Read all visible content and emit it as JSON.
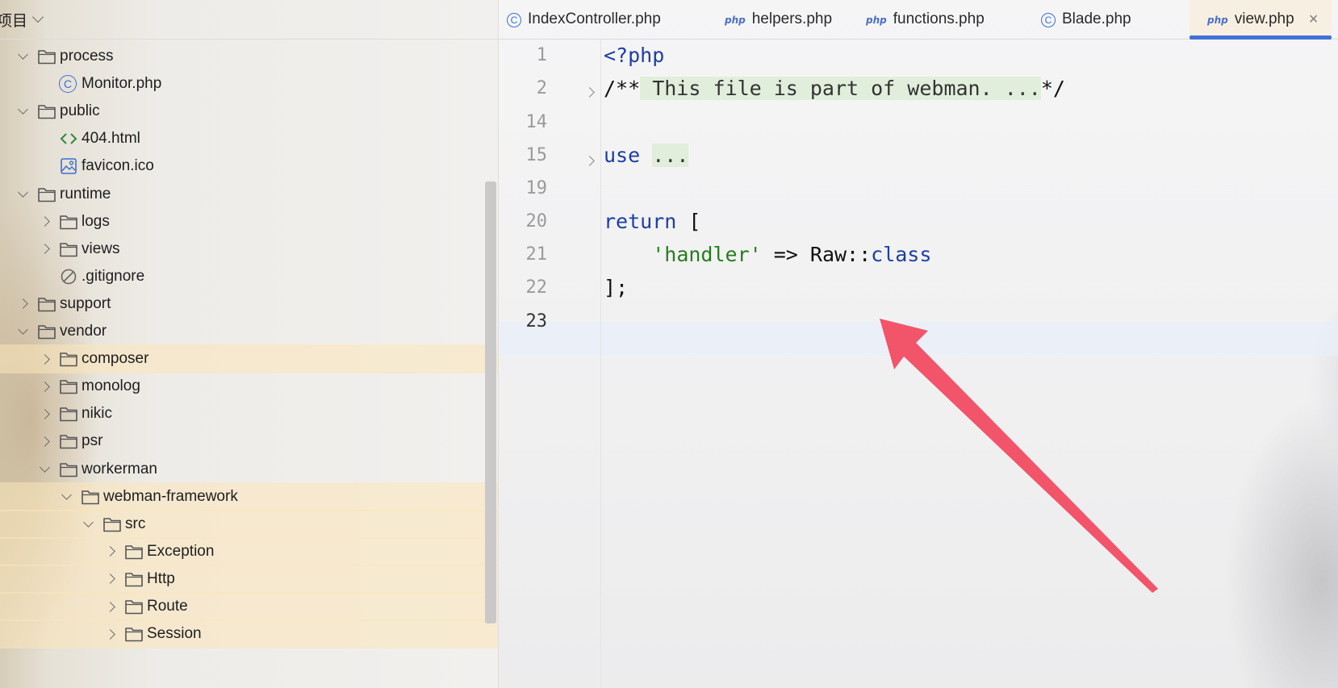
{
  "tree_header": {
    "title": "项目"
  },
  "tree": [
    {
      "label": "process",
      "type": "folder",
      "state": "open",
      "depth": 1,
      "highlight": false
    },
    {
      "label": "Monitor.php",
      "type": "class",
      "depth": 2,
      "highlight": false
    },
    {
      "label": "public",
      "type": "folder",
      "state": "open",
      "depth": 1,
      "highlight": false
    },
    {
      "label": "404.html",
      "type": "html",
      "depth": 2,
      "highlight": false
    },
    {
      "label": "favicon.ico",
      "type": "image",
      "depth": 2,
      "highlight": false
    },
    {
      "label": "runtime",
      "type": "folder",
      "state": "open",
      "depth": 1,
      "highlight": false
    },
    {
      "label": "logs",
      "type": "folder",
      "state": "closed",
      "depth": 2,
      "highlight": false
    },
    {
      "label": "views",
      "type": "folder",
      "state": "closed",
      "depth": 2,
      "highlight": false
    },
    {
      "label": ".gitignore",
      "type": "ignore",
      "depth": 2,
      "highlight": false
    },
    {
      "label": "support",
      "type": "folder",
      "state": "closed",
      "depth": 1,
      "highlight": false
    },
    {
      "label": "vendor",
      "type": "folder",
      "state": "open",
      "depth": 1,
      "highlight": false
    },
    {
      "label": "composer",
      "type": "folder",
      "state": "closed",
      "depth": 2,
      "highlight": true
    },
    {
      "label": "monolog",
      "type": "folder",
      "state": "closed",
      "depth": 2,
      "highlight": false
    },
    {
      "label": "nikic",
      "type": "folder",
      "state": "closed",
      "depth": 2,
      "highlight": false
    },
    {
      "label": "psr",
      "type": "folder",
      "state": "closed",
      "depth": 2,
      "highlight": false
    },
    {
      "label": "workerman",
      "type": "folder",
      "state": "open",
      "depth": 2,
      "highlight": false
    },
    {
      "label": "webman-framework",
      "type": "folder",
      "state": "open",
      "depth": 3,
      "highlight": true
    },
    {
      "label": "src",
      "type": "folder",
      "state": "open",
      "depth": 4,
      "highlight": true
    },
    {
      "label": "Exception",
      "type": "folder",
      "state": "closed",
      "depth": 5,
      "highlight": true
    },
    {
      "label": "Http",
      "type": "folder",
      "state": "closed",
      "depth": 5,
      "highlight": true
    },
    {
      "label": "Route",
      "type": "folder",
      "state": "closed",
      "depth": 5,
      "highlight": true
    },
    {
      "label": "Session",
      "type": "folder",
      "state": "closed",
      "depth": 5,
      "highlight": true
    }
  ],
  "tabs": [
    {
      "label": "IndexController.php",
      "icon": "class-icon",
      "active": false
    },
    {
      "label": "helpers.php",
      "icon": "php-icon",
      "active": false
    },
    {
      "label": "functions.php",
      "icon": "php-icon",
      "active": false
    },
    {
      "label": "Blade.php",
      "icon": "class-icon",
      "active": false
    },
    {
      "label": "view.php",
      "icon": "php-icon",
      "active": true,
      "close": "×"
    }
  ],
  "php_icon_text": "php",
  "class_icon_text": "C",
  "editor": {
    "lines": [
      {
        "num": "1",
        "code": "<?php"
      },
      {
        "num": "2",
        "code": "/** This file is part of webman. ...*/"
      },
      {
        "num": "14",
        "code": ""
      },
      {
        "num": "15",
        "code": "use ..."
      },
      {
        "num": "19",
        "code": ""
      },
      {
        "num": "20",
        "code": "return ["
      },
      {
        "num": "21",
        "code": "    'handler' => Raw::class"
      },
      {
        "num": "22",
        "code": "];"
      },
      {
        "num": "23",
        "code": ""
      }
    ],
    "current_line": "23"
  },
  "colors": {
    "accent": "#3e72d8",
    "keyword": "#1c3fa0",
    "string": "#267d1d",
    "fold_bg": "#dcecd6",
    "annotation_arrow": "#f2546a"
  }
}
